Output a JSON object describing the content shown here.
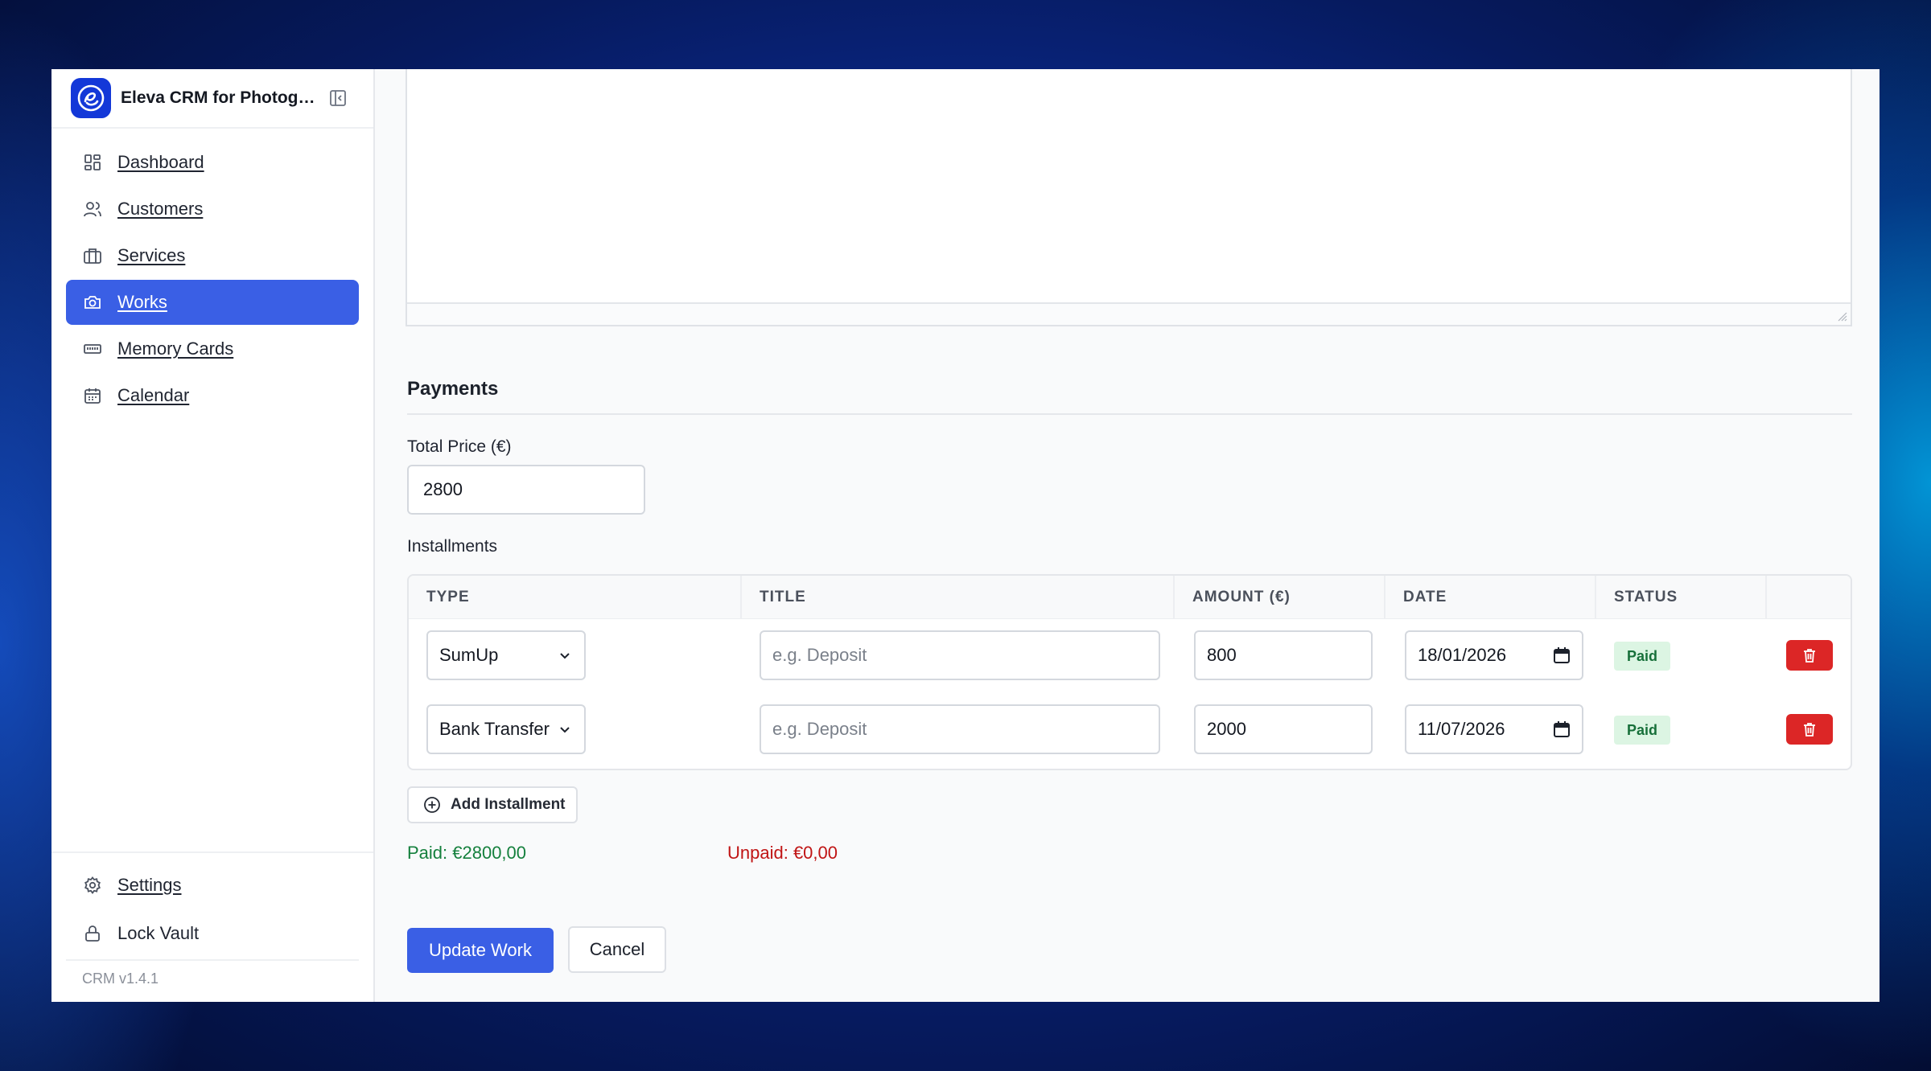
{
  "app": {
    "name": "Eleva CRM for Photographers",
    "version": "CRM v1.4.1",
    "brand_color": "#1338d8",
    "accent_color": "#3a5fe5"
  },
  "sidebar": {
    "items": [
      {
        "label": "Dashboard",
        "icon": "dashboard-icon",
        "active": false
      },
      {
        "label": "Customers",
        "icon": "users-icon",
        "active": false
      },
      {
        "label": "Services",
        "icon": "briefcase-icon",
        "active": false
      },
      {
        "label": "Works",
        "icon": "camera-icon",
        "active": true
      },
      {
        "label": "Memory Cards",
        "icon": "memory-card-icon",
        "active": false
      },
      {
        "label": "Calendar",
        "icon": "calendar-icon",
        "active": false
      }
    ],
    "footer": {
      "settings_label": "Settings",
      "lock_label": "Lock Vault"
    }
  },
  "payments": {
    "section_title": "Payments",
    "total_price_label": "Total Price (€)",
    "total_price_value": "2800",
    "installments_label": "Installments",
    "columns": [
      "TYPE",
      "TITLE",
      "AMOUNT (€)",
      "DATE",
      "STATUS"
    ],
    "rows": [
      {
        "type": "SumUp",
        "title_placeholder": "e.g. Deposit",
        "amount": "800",
        "date": "18/01/2026",
        "status": "Paid"
      },
      {
        "type": "Bank Transfer",
        "title_placeholder": "e.g. Deposit",
        "amount": "2000",
        "date": "11/07/2026",
        "status": "Paid"
      }
    ],
    "add_installment_label": "Add Installment",
    "paid_summary": "Paid: €2800,00",
    "unpaid_summary": "Unpaid: €0,00",
    "paid_color": "#15803d",
    "unpaid_color": "#c01414",
    "delete_color": "#dc2626"
  },
  "actions": {
    "update_label": "Update Work",
    "cancel_label": "Cancel"
  }
}
